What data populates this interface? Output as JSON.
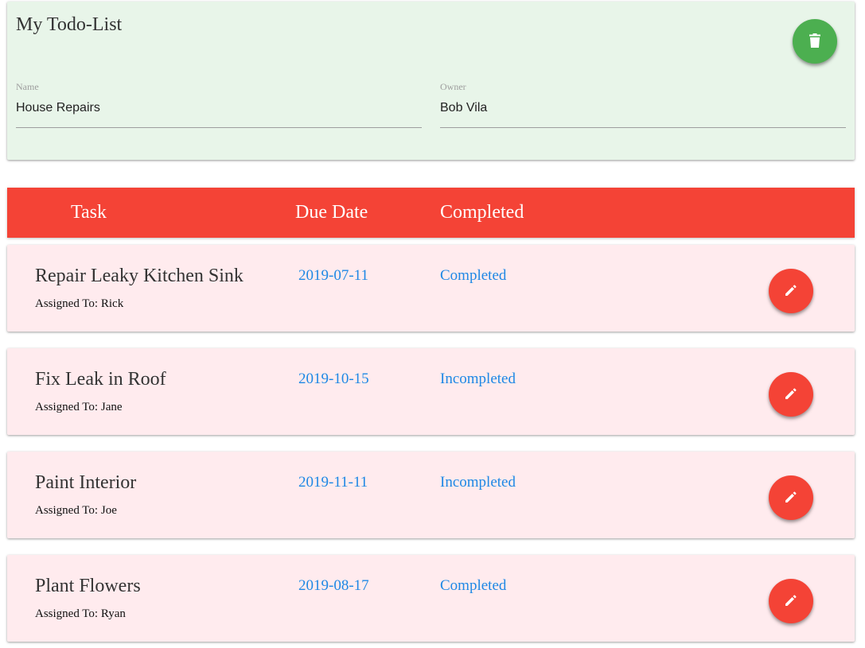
{
  "list": {
    "title": "My Todo-List",
    "name_label": "Name",
    "name_value": "House Repairs",
    "owner_label": "Owner",
    "owner_value": "Bob Vila",
    "delete_icon": "trash-icon",
    "delete_color": "#4caf50"
  },
  "table_header": {
    "task": "Task",
    "due_date": "Due Date",
    "completed": "Completed",
    "color": "#f44336"
  },
  "tasks": [
    {
      "name": "Repair Leaky Kitchen Sink",
      "assigned_prefix": "Assigned To: ",
      "assignee": "Rick",
      "due": "2019-07-11",
      "status": "Completed"
    },
    {
      "name": "Fix Leak in Roof",
      "assigned_prefix": "Assigned To: ",
      "assignee": "Jane",
      "due": "2019-10-15",
      "status": "Incompleted"
    },
    {
      "name": "Paint Interior",
      "assigned_prefix": "Assigned To: ",
      "assignee": "Joe",
      "due": "2019-11-11",
      "status": "Incompleted"
    },
    {
      "name": "Plant Flowers",
      "assigned_prefix": "Assigned To: ",
      "assignee": "Ryan",
      "due": "2019-08-17",
      "status": "Completed"
    }
  ],
  "colors": {
    "top_card_bg": "#e8f5e9",
    "task_card_bg": "#ffebee",
    "link_blue": "#1e88e5",
    "edit_button": "#f44336"
  },
  "icons": {
    "edit": "pencil-icon",
    "delete": "trash-icon"
  }
}
